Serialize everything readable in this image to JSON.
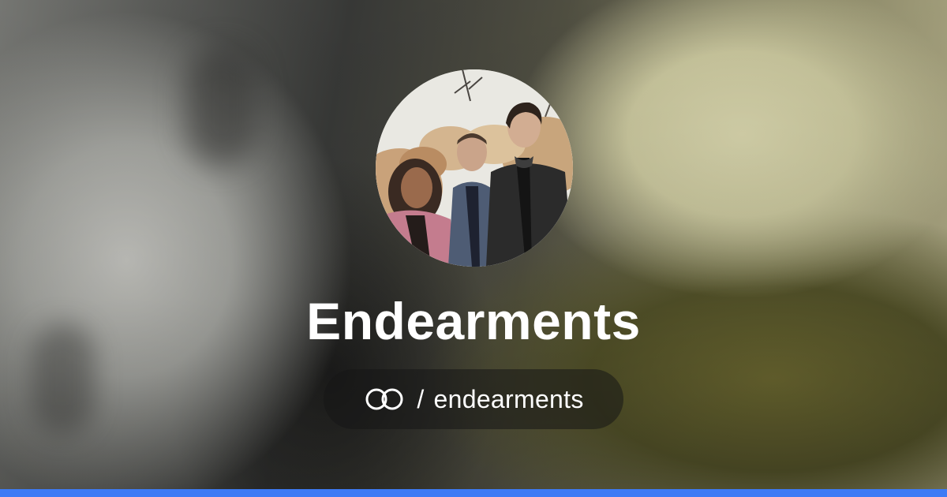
{
  "profile": {
    "name": "Endearments",
    "handle_prefix": "/",
    "handle": "endearments",
    "avatar_alt": "Endearments band photo"
  },
  "icons": {
    "brand": "linked-rings-icon"
  },
  "colors": {
    "accent_bar": "#3d7bf5",
    "text": "#ffffff",
    "pill_background": "rgba(22,22,22,0.55)"
  }
}
